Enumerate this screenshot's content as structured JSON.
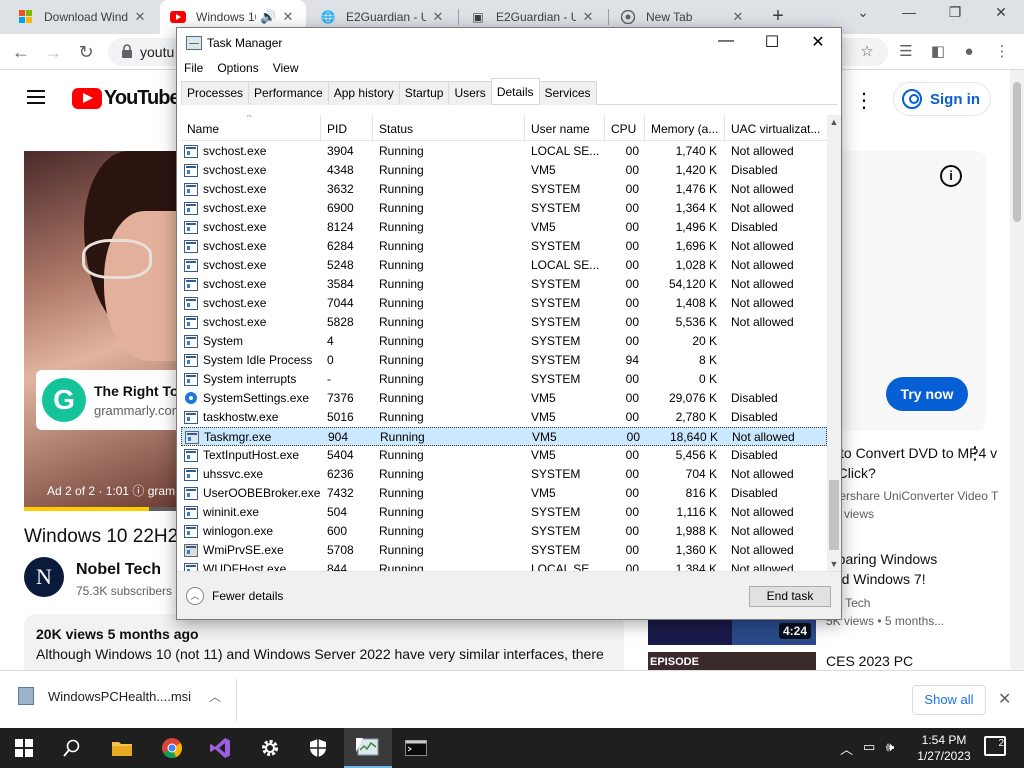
{
  "browser": {
    "tabs": [
      {
        "title": "Download Wind",
        "icon": "windows-icon"
      },
      {
        "title": "Windows 10",
        "icon": "youtube-icon",
        "audio": true
      },
      {
        "title": "E2Guardian - Ur",
        "icon": "globe-icon"
      },
      {
        "title": "E2Guardian - Ur",
        "icon": "image-icon"
      },
      {
        "title": "New Tab",
        "icon": "chrome-icon"
      }
    ],
    "url": "youtu"
  },
  "youtube": {
    "logo_text": "YouTube",
    "sign_in": "Sign in",
    "ad": {
      "card_title": "The Right Tone",
      "card_domain": "grammarly.com",
      "ad_info": "Ad 2 of 2 · 1:01  ⓘ  gram"
    },
    "video_title": "Windows 10 22H2",
    "channel": {
      "name": "Nobel Tech",
      "subscribers": "75.3K subscribers",
      "avatar_text": "N"
    },
    "description": {
      "meta": "20K views  5 months ago",
      "text": "Although Windows 10 (not 11) and Windows Server 2022 have very similar interfaces, there"
    },
    "side_ad": {
      "button": "Try now"
    },
    "recommendations": [
      {
        "title1": "w to Convert DVD to MP4 v",
        "title2": "e Click?",
        "channel": "ndershare UniConverter Video T",
        "views": "0K views"
      },
      {
        "title1": "mparing Windows",
        "title2": "and Windows 7!",
        "channel": "bel Tech",
        "views": "5K views • 5 months...",
        "duration": "4:24"
      },
      {
        "title1": "CES 2023 PC",
        "thumb_text": "EPISODE"
      }
    ]
  },
  "downloads": {
    "file": "WindowsPCHealth....msi",
    "show_all": "Show all"
  },
  "taskbar": {
    "time": "1:54 PM",
    "date": "1/27/2023",
    "notifications": "2"
  },
  "task_manager": {
    "title": "Task Manager",
    "menu": [
      "File",
      "Options",
      "View"
    ],
    "tabs": [
      "Processes",
      "Performance",
      "App history",
      "Startup",
      "Users",
      "Details",
      "Services"
    ],
    "active_tab": "Details",
    "columns": [
      "Name",
      "PID",
      "Status",
      "User name",
      "CPU",
      "Memory (a...",
      "UAC virtualizat..."
    ],
    "rows": [
      {
        "name": "svchost.exe",
        "pid": "3904",
        "status": "Running",
        "user": "LOCAL SE...",
        "cpu": "00",
        "mem": "1,740 K",
        "uac": "Not allowed",
        "icon": "window"
      },
      {
        "name": "svchost.exe",
        "pid": "4348",
        "status": "Running",
        "user": "VM5",
        "cpu": "00",
        "mem": "1,420 K",
        "uac": "Disabled",
        "icon": "window"
      },
      {
        "name": "svchost.exe",
        "pid": "3632",
        "status": "Running",
        "user": "SYSTEM",
        "cpu": "00",
        "mem": "1,476 K",
        "uac": "Not allowed",
        "icon": "window"
      },
      {
        "name": "svchost.exe",
        "pid": "6900",
        "status": "Running",
        "user": "SYSTEM",
        "cpu": "00",
        "mem": "1,364 K",
        "uac": "Not allowed",
        "icon": "window"
      },
      {
        "name": "svchost.exe",
        "pid": "8124",
        "status": "Running",
        "user": "VM5",
        "cpu": "00",
        "mem": "1,496 K",
        "uac": "Disabled",
        "icon": "window"
      },
      {
        "name": "svchost.exe",
        "pid": "6284",
        "status": "Running",
        "user": "SYSTEM",
        "cpu": "00",
        "mem": "1,696 K",
        "uac": "Not allowed",
        "icon": "window"
      },
      {
        "name": "svchost.exe",
        "pid": "5248",
        "status": "Running",
        "user": "LOCAL SE...",
        "cpu": "00",
        "mem": "1,028 K",
        "uac": "Not allowed",
        "icon": "window"
      },
      {
        "name": "svchost.exe",
        "pid": "3584",
        "status": "Running",
        "user": "SYSTEM",
        "cpu": "00",
        "mem": "54,120 K",
        "uac": "Not allowed",
        "icon": "window"
      },
      {
        "name": "svchost.exe",
        "pid": "7044",
        "status": "Running",
        "user": "SYSTEM",
        "cpu": "00",
        "mem": "1,408 K",
        "uac": "Not allowed",
        "icon": "window"
      },
      {
        "name": "svchost.exe",
        "pid": "5828",
        "status": "Running",
        "user": "SYSTEM",
        "cpu": "00",
        "mem": "5,536 K",
        "uac": "Not allowed",
        "icon": "window"
      },
      {
        "name": "System",
        "pid": "4",
        "status": "Running",
        "user": "SYSTEM",
        "cpu": "00",
        "mem": "20 K",
        "uac": "",
        "icon": "window"
      },
      {
        "name": "System Idle Process",
        "pid": "0",
        "status": "Running",
        "user": "SYSTEM",
        "cpu": "94",
        "mem": "8 K",
        "uac": "",
        "icon": "window"
      },
      {
        "name": "System interrupts",
        "pid": "-",
        "status": "Running",
        "user": "SYSTEM",
        "cpu": "00",
        "mem": "0 K",
        "uac": "",
        "icon": "window"
      },
      {
        "name": "SystemSettings.exe",
        "pid": "7376",
        "status": "Running",
        "user": "VM5",
        "cpu": "00",
        "mem": "29,076 K",
        "uac": "Disabled",
        "icon": "gear"
      },
      {
        "name": "taskhostw.exe",
        "pid": "5016",
        "status": "Running",
        "user": "VM5",
        "cpu": "00",
        "mem": "2,780 K",
        "uac": "Disabled",
        "icon": "window"
      },
      {
        "name": "Taskmgr.exe",
        "pid": "904",
        "status": "Running",
        "user": "VM5",
        "cpu": "00",
        "mem": "18,640 K",
        "uac": "Not allowed",
        "icon": "tm2",
        "selected": true
      },
      {
        "name": "TextInputHost.exe",
        "pid": "5404",
        "status": "Running",
        "user": "VM5",
        "cpu": "00",
        "mem": "5,456 K",
        "uac": "Disabled",
        "icon": "window"
      },
      {
        "name": "uhssvc.exe",
        "pid": "6236",
        "status": "Running",
        "user": "SYSTEM",
        "cpu": "00",
        "mem": "704 K",
        "uac": "Not allowed",
        "icon": "window"
      },
      {
        "name": "UserOOBEBroker.exe",
        "pid": "7432",
        "status": "Running",
        "user": "VM5",
        "cpu": "00",
        "mem": "816 K",
        "uac": "Disabled",
        "icon": "window"
      },
      {
        "name": "wininit.exe",
        "pid": "504",
        "status": "Running",
        "user": "SYSTEM",
        "cpu": "00",
        "mem": "1,116 K",
        "uac": "Not allowed",
        "icon": "window"
      },
      {
        "name": "winlogon.exe",
        "pid": "600",
        "status": "Running",
        "user": "SYSTEM",
        "cpu": "00",
        "mem": "1,988 K",
        "uac": "Not allowed",
        "icon": "window"
      },
      {
        "name": "WmiPrvSE.exe",
        "pid": "5708",
        "status": "Running",
        "user": "SYSTEM",
        "cpu": "00",
        "mem": "1,360 K",
        "uac": "Not allowed",
        "icon": "wmi"
      },
      {
        "name": "WUDFHost.exe",
        "pid": "844",
        "status": "Running",
        "user": "LOCAL SE...",
        "cpu": "00",
        "mem": "1,384 K",
        "uac": "Not allowed",
        "icon": "window"
      }
    ],
    "fewer_details": "Fewer details",
    "end_task": "End task"
  }
}
